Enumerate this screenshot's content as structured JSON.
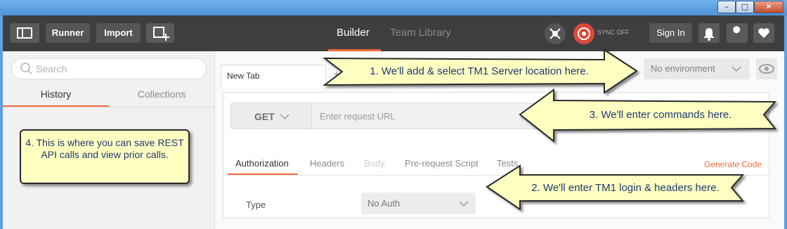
{
  "window": {
    "controls": [
      "–",
      "□",
      "✕"
    ]
  },
  "toolbar": {
    "runner_label": "Runner",
    "import_label": "Import",
    "tabs": [
      {
        "label": "Builder"
      },
      {
        "label": "Team Library"
      }
    ],
    "sync_label": "SYNC OFF",
    "signin_label": "Sign In"
  },
  "sidebar": {
    "search_placeholder": "Search",
    "tabs": [
      {
        "label": "History"
      },
      {
        "label": "Collections"
      }
    ]
  },
  "main": {
    "tab_label": "New Tab",
    "add_tab": "+",
    "environment": "No environment",
    "method": "GET",
    "url_placeholder": "Enter request URL",
    "request_tabs": [
      {
        "label": "Authorization"
      },
      {
        "label": "Headers"
      },
      {
        "label": "Body"
      },
      {
        "label": "Pre-request Script"
      },
      {
        "label": "Tests"
      }
    ],
    "generate_code_label": "Generate Code",
    "type_label": "Type",
    "auth_type": "No Auth"
  },
  "callouts": {
    "c1": "1. We'll add & select TM1 Server location here.",
    "c2": "2. We'll enter TM1 login & headers here.",
    "c3": "3. We'll enter commands here.",
    "c4": "4. This is where you can save REST API calls and view prior calls."
  },
  "colors": {
    "accent": "#f26b3a",
    "toolbar_bg": "#3e3e3e",
    "callout_fill": "#ffffc2",
    "callout_text": "#1f3a6f"
  }
}
